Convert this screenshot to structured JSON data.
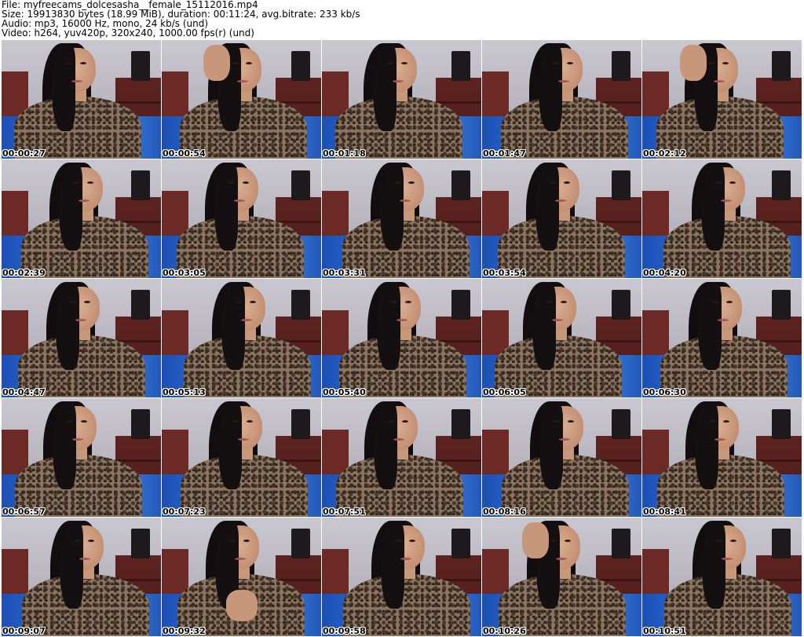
{
  "header": {
    "file_line": "File: myfreecams_dolcesasha__female_15112016.mp4",
    "size_line": "Size: 19913830 bytes (18.99 MiB), duration: 00:11:24, avg.bitrate: 233 kb/s",
    "audio_line": "Audio: mp3, 16000 Hz, mono, 24 kb/s (und)",
    "video_line": "Video: h264, yuv420p, 320x240, 1000.00 fps(r) (und)"
  },
  "thumbnails": [
    {
      "time": "00:00:27",
      "pose": "neutral"
    },
    {
      "time": "00:00:54",
      "pose": "hand-left"
    },
    {
      "time": "00:01:18",
      "pose": "neutral"
    },
    {
      "time": "00:01:47",
      "pose": "neutral"
    },
    {
      "time": "00:02:12",
      "pose": "hand-left"
    },
    {
      "time": "00:02:39",
      "pose": "neutral"
    },
    {
      "time": "00:03:05",
      "pose": "neutral"
    },
    {
      "time": "00:03:31",
      "pose": "neutral"
    },
    {
      "time": "00:03:54",
      "pose": "neutral"
    },
    {
      "time": "00:04:20",
      "pose": "neutral"
    },
    {
      "time": "00:04:47",
      "pose": "neutral"
    },
    {
      "time": "00:05:13",
      "pose": "neutral"
    },
    {
      "time": "00:05:40",
      "pose": "neutral"
    },
    {
      "time": "00:06:05",
      "pose": "neutral"
    },
    {
      "time": "00:06:30",
      "pose": "neutral"
    },
    {
      "time": "00:06:57",
      "pose": "neutral"
    },
    {
      "time": "00:07:23",
      "pose": "neutral"
    },
    {
      "time": "00:07:51",
      "pose": "neutral"
    },
    {
      "time": "00:08:16",
      "pose": "neutral"
    },
    {
      "time": "00:08:41",
      "pose": "neutral"
    },
    {
      "time": "00:09:07",
      "pose": "neutral"
    },
    {
      "time": "00:09:32",
      "pose": "hands-clasped"
    },
    {
      "time": "00:09:58",
      "pose": "neutral"
    },
    {
      "time": "00:10:26",
      "pose": "hand-left"
    },
    {
      "time": "00:10:51",
      "pose": "neutral"
    }
  ]
}
